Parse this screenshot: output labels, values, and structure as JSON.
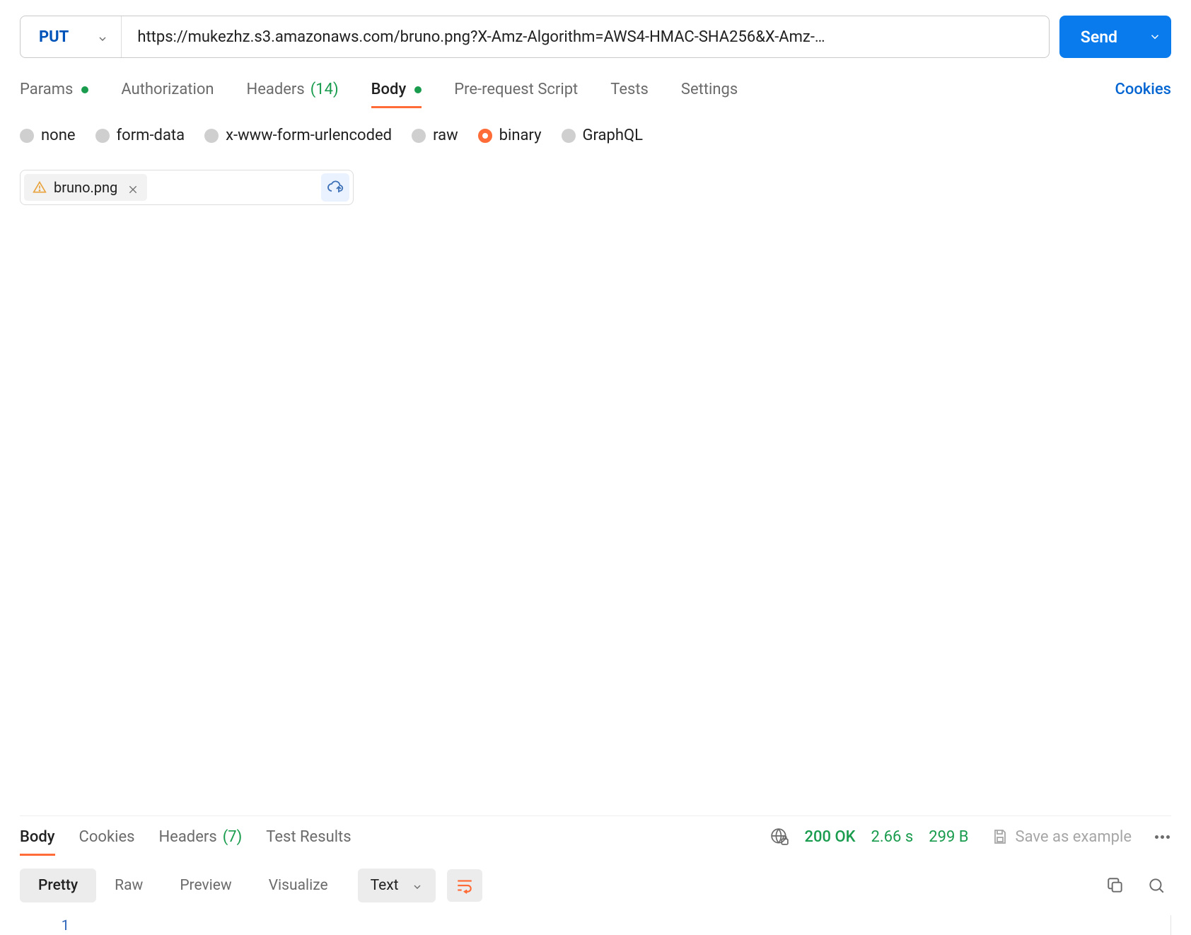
{
  "request": {
    "method": "PUT",
    "url": "https://mukezhz.s3.amazonaws.com/bruno.png?X-Amz-Algorithm=AWS4-HMAC-SHA256&X-Amz-…",
    "send_label": "Send"
  },
  "tabs": {
    "params": "Params",
    "authorization": "Authorization",
    "headers": "Headers",
    "headers_count": "(14)",
    "body": "Body",
    "prerequest": "Pre-request Script",
    "tests": "Tests",
    "settings": "Settings",
    "cookies": "Cookies"
  },
  "body_types": {
    "none": "none",
    "form_data": "form-data",
    "xwww": "x-www-form-urlencoded",
    "raw": "raw",
    "binary": "binary",
    "graphql": "GraphQL",
    "selected": "binary"
  },
  "file": {
    "name": "bruno.png"
  },
  "response": {
    "tabs": {
      "body": "Body",
      "cookies": "Cookies",
      "headers": "Headers",
      "headers_count": "(7)",
      "test_results": "Test Results"
    },
    "status": "200 OK",
    "time": "2.66 s",
    "size": "299 B",
    "save_example": "Save as example",
    "views": {
      "pretty": "Pretty",
      "raw": "Raw",
      "preview": "Preview",
      "visualize": "Visualize"
    },
    "format_select": "Text",
    "line_number": "1"
  }
}
